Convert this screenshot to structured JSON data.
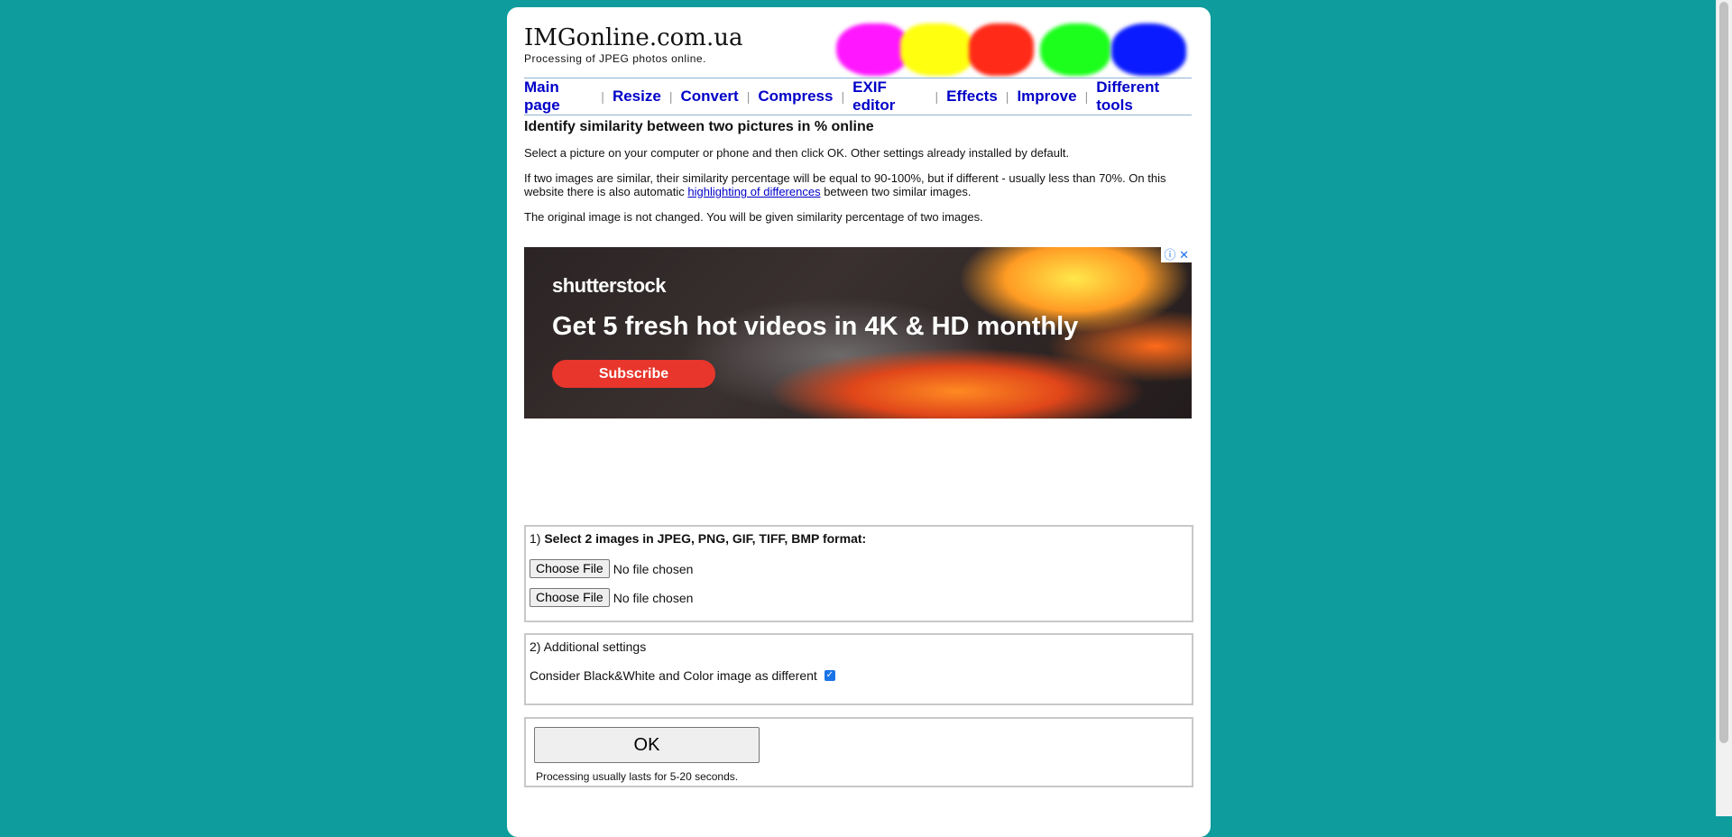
{
  "site": {
    "title": "IMGonline.com.ua",
    "tagline": "Processing of JPEG photos online."
  },
  "blob_colors": [
    "#ff18ff",
    "#ffff10",
    "#ff2a18",
    "#1cff1c",
    "#0a1cff"
  ],
  "nav": {
    "items": [
      "Main page",
      "Resize",
      "Convert",
      "Compress",
      "EXIF editor",
      "Effects",
      "Improve",
      "Different tools"
    ],
    "separator": "|"
  },
  "content": {
    "heading": "Identify similarity between two pictures in % online",
    "p1": "Select a picture on your computer or phone and then click OK. Other settings already installed by default.",
    "p2_before": "If two images are similar, their similarity percentage will be equal to 90-100%, but if different - usually less than 70%. On this website there is also automatic ",
    "p2_link": "highlighting of differences",
    "p2_after": " between two similar images.",
    "p3": "The original image is not changed. You will be given similarity percentage of two images."
  },
  "ad": {
    "logo": "shutterstock",
    "headline": "Get 5 fresh hot videos in 4K & HD monthly",
    "button": "Subscribe",
    "info_icon": "info-icon",
    "close_icon": "close-icon"
  },
  "form": {
    "step1_prefix": "1) ",
    "step1_label": "Select 2 images in JPEG, PNG, GIF, TIFF, BMP format:",
    "choose_file": "Choose File",
    "no_file": "No file chosen",
    "step2_label": "2) Additional settings",
    "checkbox_label": "Consider Black&White and Color image as different",
    "checkbox_checked": true,
    "ok_label": "OK",
    "ok_note": "Processing usually lasts for 5-20 seconds."
  }
}
